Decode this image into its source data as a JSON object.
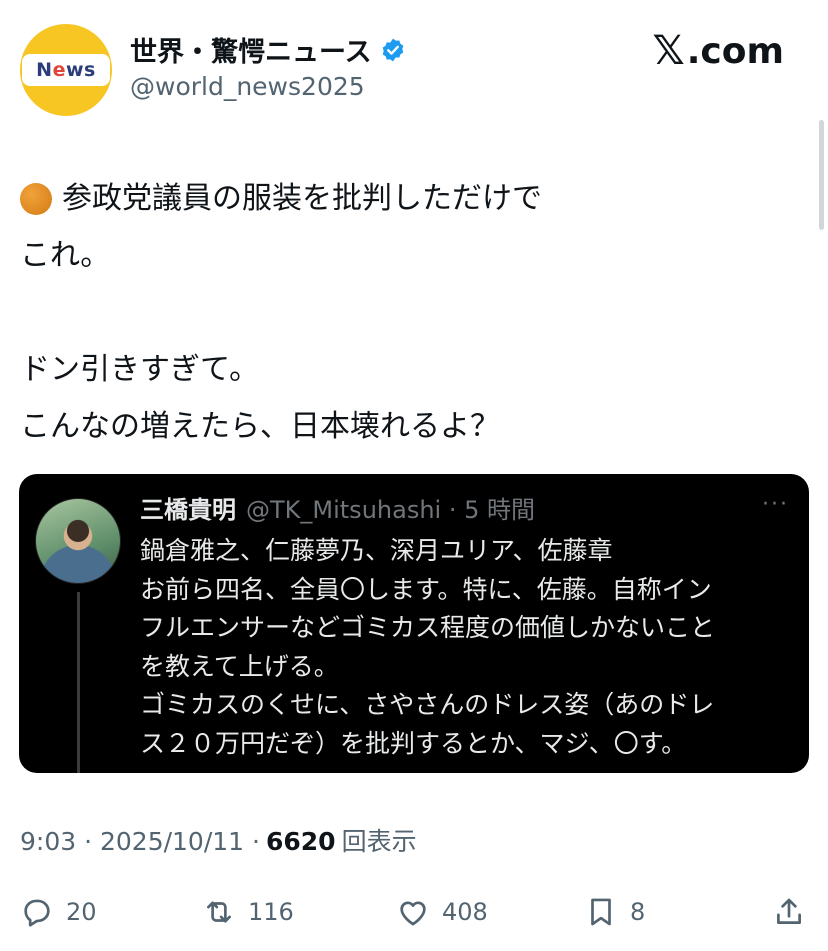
{
  "header": {
    "avatar_text_left": "N",
    "avatar_text_e": "e",
    "avatar_text_right": "ws",
    "display_name": "世界・驚愕ニュース",
    "handle": "@world_news2025",
    "brand_x": "𝕏",
    "brand_suffix": ".com"
  },
  "tweet": {
    "lines": [
      "参政党議員の服装を批判しただけで",
      "これ。",
      "",
      "ドン引きすぎて。",
      "こんなの増えたら、日本壊れるよ？"
    ]
  },
  "quote": {
    "name": "三橋貴明",
    "meta": "@TK_Mitsuhashi · 5 時間",
    "more": "···",
    "lines": [
      "鍋倉雅之、仁藤夢乃、深月ユリア、佐藤章",
      "お前ら四名、全員〇します。特に、佐藤。自称イン",
      "フルエンサーなどゴミカス程度の価値しかないこと",
      "を教えて上げる。",
      "ゴミカスのくせに、さやさんのドレス姿（あのドレ",
      "ス２０万円だぞ）を批判するとか、マジ、〇す。"
    ]
  },
  "meta": {
    "time_date": "9:03 · 2025/10/11 ·",
    "views": "6620",
    "views_label": "回表示"
  },
  "actions": {
    "replies": "20",
    "reposts": "116",
    "likes": "408",
    "bookmarks": "8"
  },
  "colors": {
    "text": "#0f1419",
    "secondary": "#536471",
    "verified": "#1d9bf0",
    "avatar_bg": "#f7c623",
    "quote_bg": "#000000"
  }
}
